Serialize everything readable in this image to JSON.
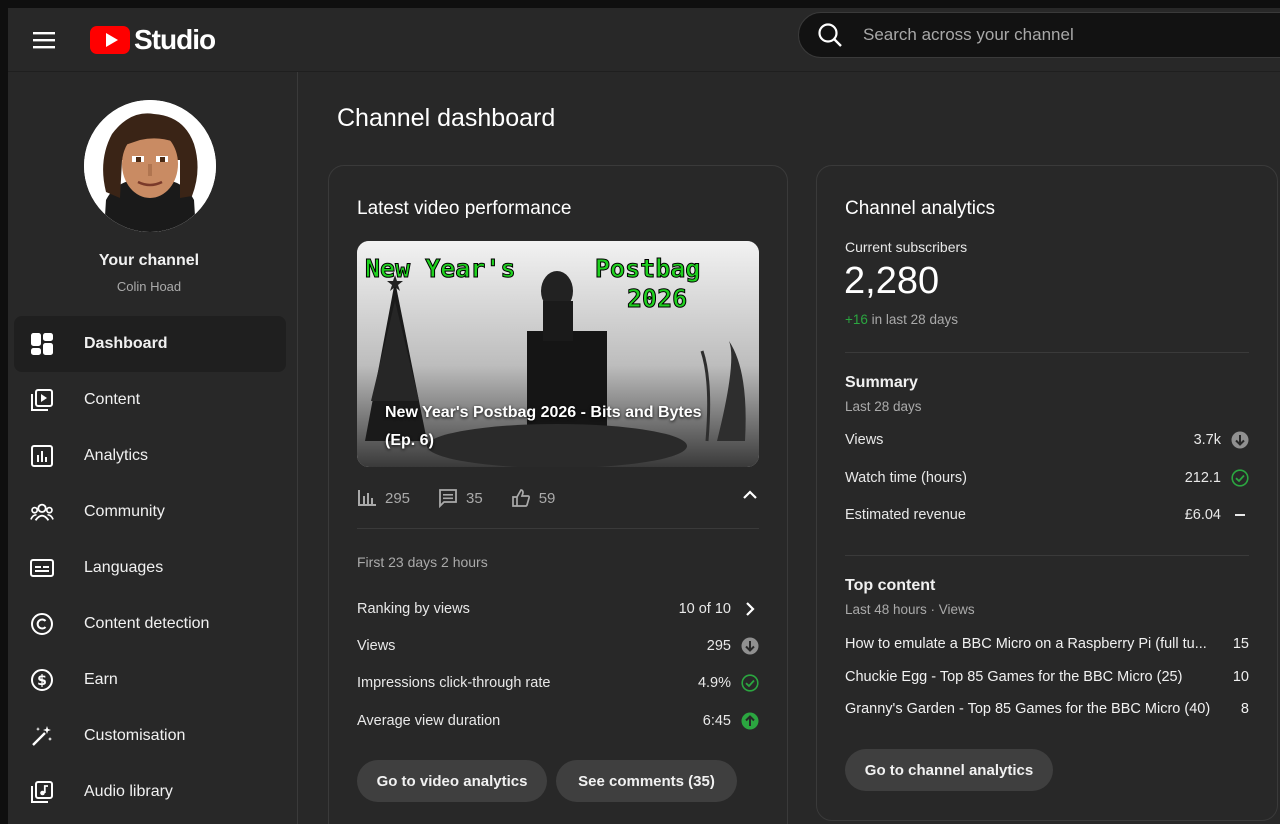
{
  "app": {
    "name": "Studio"
  },
  "search": {
    "placeholder": "Search across your channel"
  },
  "channel": {
    "title": "Your channel",
    "name": "Colin Hoad"
  },
  "sidebar": {
    "items": [
      {
        "label": "Dashboard",
        "icon": "dashboard-icon",
        "active": true
      },
      {
        "label": "Content",
        "icon": "content-icon"
      },
      {
        "label": "Analytics",
        "icon": "analytics-icon"
      },
      {
        "label": "Community",
        "icon": "community-icon"
      },
      {
        "label": "Languages",
        "icon": "subtitles-icon"
      },
      {
        "label": "Content detection",
        "icon": "copyright-icon"
      },
      {
        "label": "Earn",
        "icon": "dollar-icon"
      },
      {
        "label": "Customisation",
        "icon": "magic-wand-icon"
      },
      {
        "label": "Audio library",
        "icon": "audio-library-icon"
      }
    ]
  },
  "page": {
    "title": "Channel dashboard"
  },
  "latest_video": {
    "card_title": "Latest video performance",
    "thumbnail_text_left": "New Year's",
    "thumbnail_text_right_1": "Postbag",
    "thumbnail_text_right_2": "2026",
    "video_title": "New Year's Postbag 2026 - Bits and Bytes (Ep. 6)",
    "views": "295",
    "comments": "35",
    "likes": "59",
    "period": "First 23 days 2 hours",
    "metrics": {
      "ranking_label": "Ranking by views",
      "ranking_value": "10 of 10",
      "views_label": "Views",
      "views_value": "295",
      "ctr_label": "Impressions click-through rate",
      "ctr_value": "4.9%",
      "avd_label": "Average view duration",
      "avd_value": "6:45"
    },
    "buttons": {
      "analytics": "Go to video analytics",
      "comments": "See comments (35)"
    }
  },
  "channel_analytics": {
    "card_title": "Channel analytics",
    "subscribers_label": "Current subscribers",
    "subscribers_value": "2,280",
    "subscribers_delta": "+16",
    "subscribers_delta_suffix": " in last 28 days",
    "summary": {
      "title": "Summary",
      "period": "Last 28 days",
      "views_label": "Views",
      "views_value": "3.7k",
      "watch_label": "Watch time (hours)",
      "watch_value": "212.1",
      "revenue_label": "Estimated revenue",
      "revenue_value": "£6.04"
    },
    "top_content": {
      "title": "Top content",
      "period": "Last 48 hours · Views",
      "items": [
        {
          "title": "How to emulate a BBC Micro on a Raspberry Pi (full tu...",
          "views": "15"
        },
        {
          "title": "Chuckie Egg - Top 85 Games for the BBC Micro (25)",
          "views": "10"
        },
        {
          "title": "Granny's Garden - Top 85 Games for the BBC Micro (40)",
          "views": "8"
        }
      ]
    },
    "button": "Go to channel analytics"
  },
  "colors": {
    "brand_red": "#ff0000",
    "positive_green": "#2ba640",
    "neutral_grey": "#909090"
  }
}
